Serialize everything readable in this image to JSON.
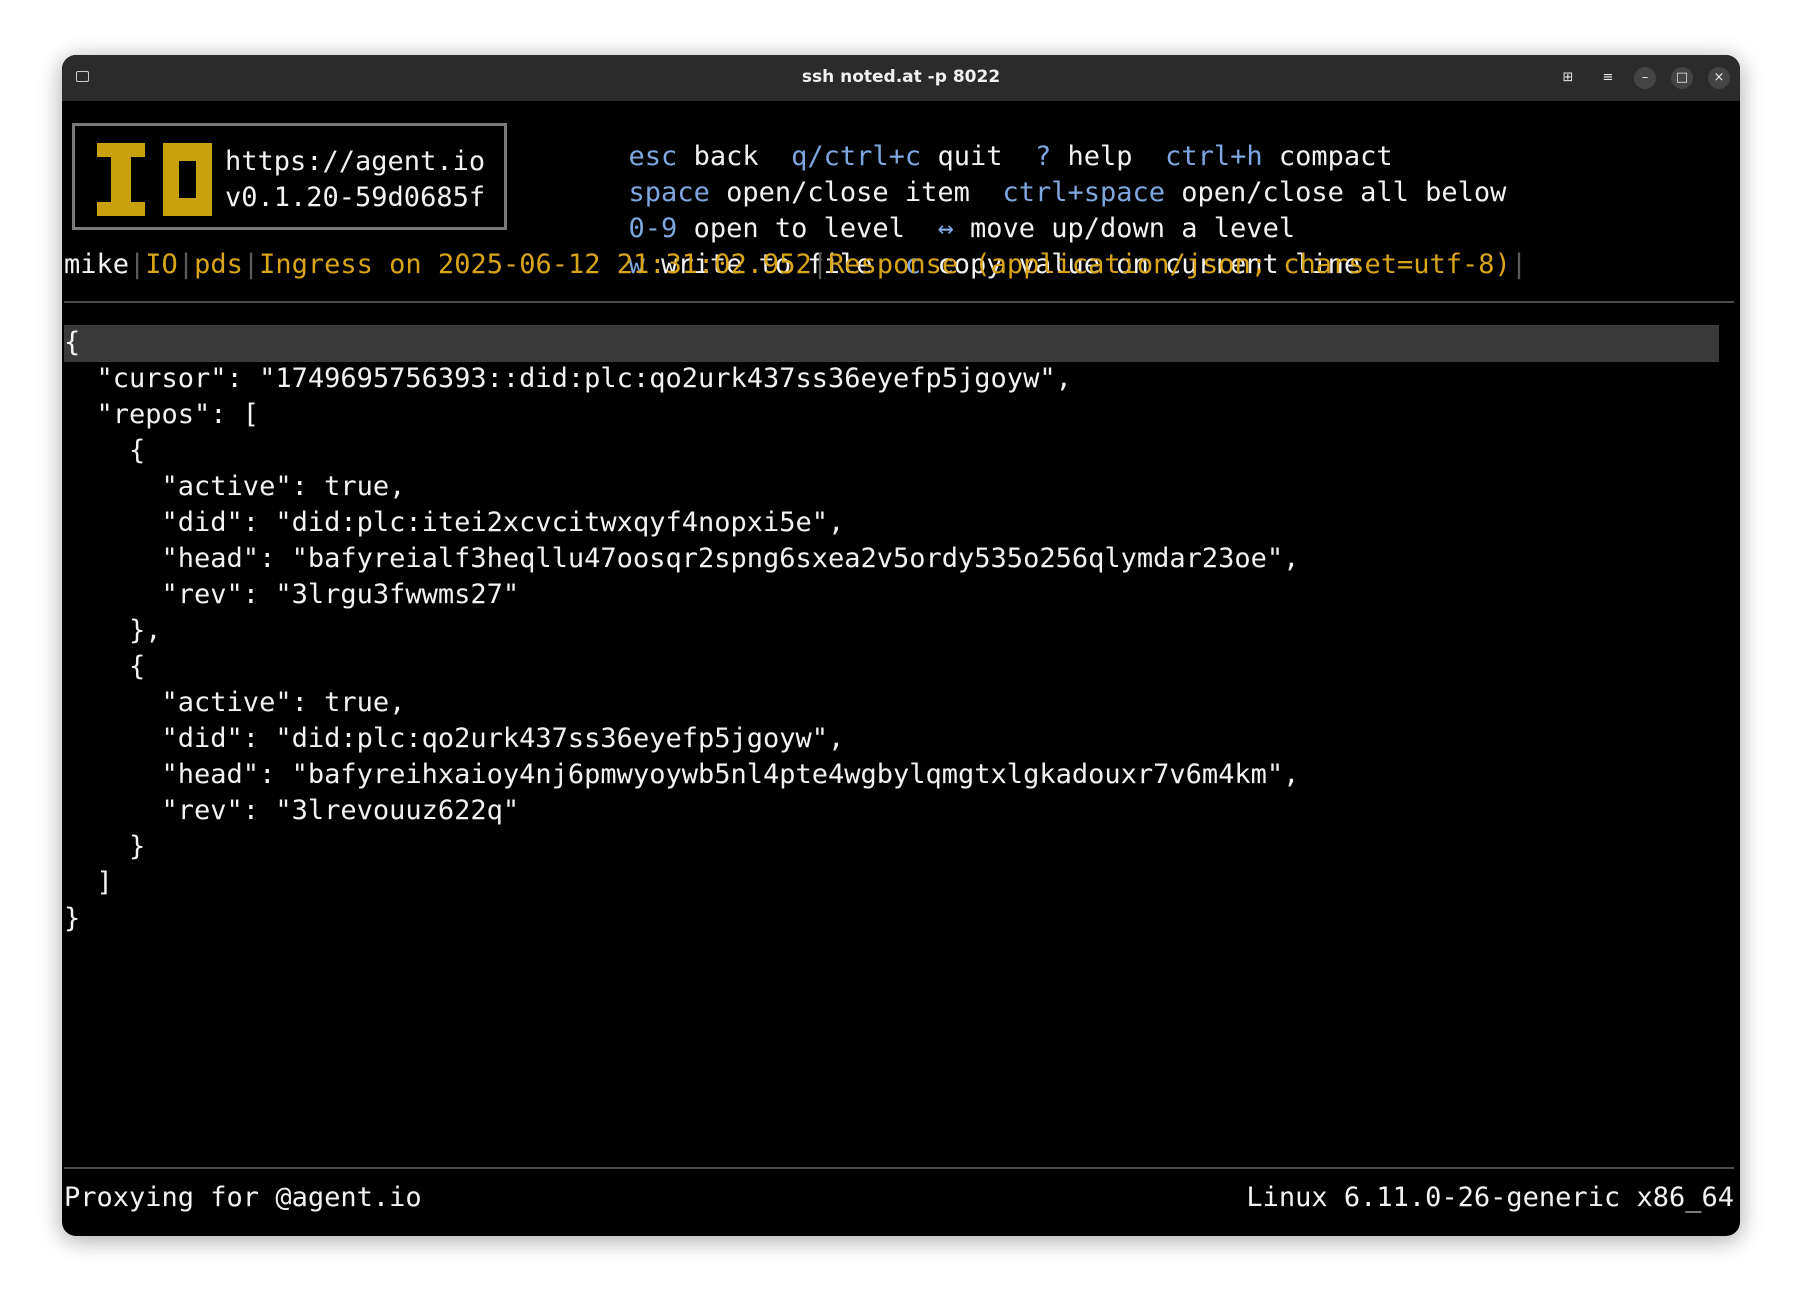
{
  "window": {
    "title": "ssh noted.at -p 8022",
    "buttons": [
      "grid-icon",
      "menu-icon",
      "minimize-icon",
      "maximize-icon",
      "close-icon"
    ],
    "button_glyphs": {
      "grid": "⊞",
      "menu": "≡",
      "minimize": "–",
      "maximize": "□",
      "close": "×"
    }
  },
  "logo": {
    "mark": "IO",
    "url": "https://agent.io",
    "version": "v0.1.20-59d0685f",
    "color": "#c9a00e"
  },
  "help": [
    [
      {
        "key": "esc",
        "desc": "back"
      },
      {
        "key": "q/ctrl+c",
        "desc": "quit"
      },
      {
        "key": "?",
        "desc": "help"
      },
      {
        "key": "ctrl+h",
        "desc": "compact"
      }
    ],
    [
      {
        "key": "space",
        "desc": "open/close item"
      },
      {
        "key": "ctrl+space",
        "desc": "open/close all below"
      }
    ],
    [
      {
        "key": "0-9",
        "desc": "open to level"
      },
      {
        "key": "↔",
        "desc": "move up/down a level"
      }
    ],
    [
      {
        "key": "w",
        "desc": "write to file"
      },
      {
        "key": "c",
        "desc": "copy value on current line"
      }
    ]
  ],
  "breadcrumb": {
    "user": "mike",
    "items": [
      "IO",
      "pds",
      "Ingress on 2025-06-12 21:31:02.952",
      "Response (application/json; charset=utf-8)"
    ],
    "separator": "|"
  },
  "json_lines": [
    "{",
    "  \"cursor\": \"1749695756393::did:plc:qo2urk437ss36eyefp5jgoyw\",",
    "  \"repos\": [",
    "    {",
    "      \"active\": true,",
    "      \"did\": \"did:plc:itei2xcvcitwxqyf4nopxi5e\",",
    "      \"head\": \"bafyreialf3heqllu47oosqr2spng6sxea2v5ordy535o256qlymdar23oe\",",
    "      \"rev\": \"3lrgu3fwwms27\"",
    "    },",
    "    {",
    "      \"active\": true,",
    "      \"did\": \"did:plc:qo2urk437ss36eyefp5jgoyw\",",
    "      \"head\": \"bafyreihxaioy4nj6pmwyoywb5nl4pte4wgbylqmgtxlgkadouxr7v6m4km\",",
    "      \"rev\": \"3lrevouuz622q\"",
    "    }",
    "  ]",
    "}"
  ],
  "footer": {
    "left": "Proxying for @agent.io",
    "right": "Linux 6.11.0-26-generic x86_64"
  },
  "colors": {
    "key": "#7da7de",
    "accent": "#d8a418",
    "background": "#000000",
    "titlebar": "#2b2b2b",
    "cursor_row": "#3a3a3a"
  }
}
